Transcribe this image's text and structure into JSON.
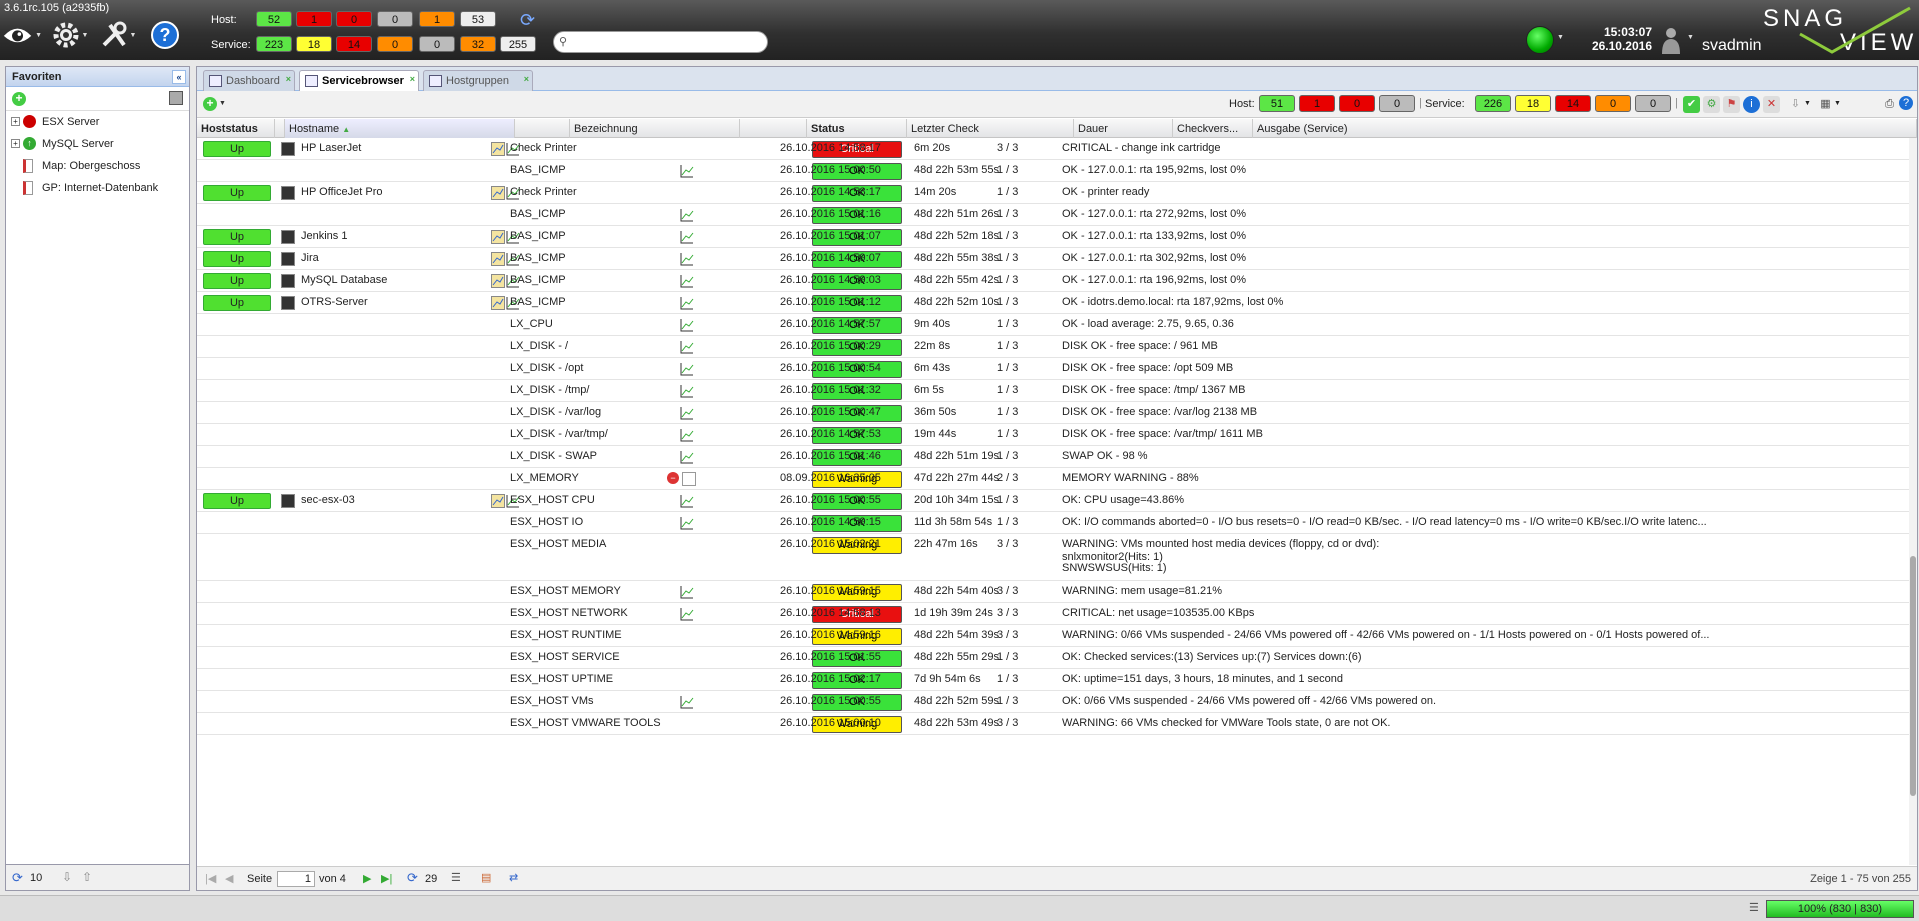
{
  "app": {
    "version": "3.6.1rc.105 (a2935fb)"
  },
  "header": {
    "host_label": "Host:",
    "service_label": "Service:",
    "host_counts": [
      "52",
      "1",
      "0",
      "0",
      "1",
      "53"
    ],
    "service_counts": [
      "223",
      "18",
      "14",
      "0",
      "0",
      "32",
      "255"
    ],
    "search_placeholder": "",
    "time": "15:03:07",
    "date": "26.10.2016",
    "user": "svadmin",
    "logo_text_top": "SNAG",
    "logo_text_bottom": "VIEW"
  },
  "sidebar": {
    "title": "Favoriten",
    "items": [
      {
        "label": "ESX Server",
        "icon": "red-circle-icon",
        "color": "#cc0000"
      },
      {
        "label": "MySQL Server",
        "icon": "green-up-icon",
        "color": "#33aa33"
      },
      {
        "label": "Map: Obergeschoss",
        "icon": "map-icon",
        "color": "#ffffff"
      },
      {
        "label": "GP: Internet-Datenbank",
        "icon": "graph-icon",
        "color": "#ffffff"
      }
    ],
    "footer_count": "10"
  },
  "tabs": [
    {
      "label": "Dashboard"
    },
    {
      "label": "Servicebrowser"
    },
    {
      "label": "Hostgruppen"
    }
  ],
  "toolbar": {
    "host_label": "Host:",
    "service_label": "Service:",
    "host_counts": [
      "51",
      "1",
      "0",
      "0"
    ],
    "service_counts": [
      "226",
      "18",
      "14",
      "0",
      "0"
    ]
  },
  "table": {
    "columns": [
      "Hoststatus",
      "Hostname",
      "Bezeichnung",
      "Status",
      "Letzter Check",
      "Dauer",
      "Checkvers...",
      "Ausgabe (Service)"
    ],
    "rows": [
      {
        "hoststatus": "Up",
        "hostname": "HP LaserJet",
        "service": "Check Printer",
        "status": "Critical",
        "last": "26.10.2016 14:58:17",
        "dauer": "6m 20s",
        "checks": "3 / 3",
        "output": "CRITICAL - change ink cartridge"
      },
      {
        "hoststatus": "",
        "hostname": "",
        "service": "BAS_ICMP",
        "status": "OK",
        "last": "26.10.2016 15:00:50",
        "dauer": "48d 22h 53m 55s",
        "checks": "1 / 3",
        "output": "OK - 127.0.0.1: rta 195,92ms, lost 0%"
      },
      {
        "hoststatus": "Up",
        "hostname": "HP OfficeJet Pro",
        "service": "Check Printer",
        "status": "OK",
        "last": "26.10.2016 14:58:17",
        "dauer": "14m 20s",
        "checks": "1 / 3",
        "output": "OK - printer ready"
      },
      {
        "hoststatus": "",
        "hostname": "",
        "service": "BAS_ICMP",
        "status": "OK",
        "last": "26.10.2016 15:01:16",
        "dauer": "48d 22h 51m 26s",
        "checks": "1 / 3",
        "output": "OK - 127.0.0.1: rta 272,92ms, lost 0%"
      },
      {
        "hoststatus": "Up",
        "hostname": "Jenkins 1",
        "service": "BAS_ICMP",
        "status": "OK",
        "last": "26.10.2016 15:01:07",
        "dauer": "48d 22h 52m 18s",
        "checks": "1 / 3",
        "output": "OK - 127.0.0.1: rta 133,92ms, lost 0%"
      },
      {
        "hoststatus": "Up",
        "hostname": "Jira",
        "service": "BAS_ICMP",
        "status": "OK",
        "last": "26.10.2016 14:59:07",
        "dauer": "48d 22h 55m 38s",
        "checks": "1 / 3",
        "output": "OK - 127.0.0.1: rta 302,92ms, lost 0%"
      },
      {
        "hoststatus": "Up",
        "hostname": "MySQL Database",
        "service": "BAS_ICMP",
        "status": "OK",
        "last": "26.10.2016 14:59:03",
        "dauer": "48d 22h 55m 42s",
        "checks": "1 / 3",
        "output": "OK - 127.0.0.1: rta 196,92ms, lost 0%"
      },
      {
        "hoststatus": "Up",
        "hostname": "OTRS-Server",
        "service": "BAS_ICMP",
        "status": "OK",
        "last": "26.10.2016 15:01:12",
        "dauer": "48d 22h 52m 10s",
        "checks": "1 / 3",
        "output": "OK - idotrs.demo.local: rta 187,92ms, lost 0%"
      },
      {
        "hoststatus": "",
        "hostname": "",
        "service": "LX_CPU",
        "status": "OK",
        "last": "26.10.2016 14:57:57",
        "dauer": "9m 40s",
        "checks": "1 / 3",
        "output": "OK - load average: 2.75, 9.65, 0.36"
      },
      {
        "hoststatus": "",
        "hostname": "",
        "service": "LX_DISK - /",
        "status": "OK",
        "last": "26.10.2016 15:00:29",
        "dauer": "22m 8s",
        "checks": "1 / 3",
        "output": "DISK OK - free space: / 961 MB"
      },
      {
        "hoststatus": "",
        "hostname": "",
        "service": "LX_DISK - /opt",
        "status": "OK",
        "last": "26.10.2016 15:00:54",
        "dauer": "6m 43s",
        "checks": "1 / 3",
        "output": "DISK OK - free space: /opt 509 MB"
      },
      {
        "hoststatus": "",
        "hostname": "",
        "service": "LX_DISK - /tmp/",
        "status": "OK",
        "last": "26.10.2016 15:01:32",
        "dauer": "6m 5s",
        "checks": "1 / 3",
        "output": "DISK OK - free space: /tmp/ 1367 MB"
      },
      {
        "hoststatus": "",
        "hostname": "",
        "service": "LX_DISK - /var/log",
        "status": "OK",
        "last": "26.10.2016 15:00:47",
        "dauer": "36m 50s",
        "checks": "1 / 3",
        "output": "DISK OK - free space: /var/log 2138 MB"
      },
      {
        "hoststatus": "",
        "hostname": "",
        "service": "LX_DISK - /var/tmp/",
        "status": "OK",
        "last": "26.10.2016 14:57:53",
        "dauer": "19m 44s",
        "checks": "1 / 3",
        "output": "DISK OK - free space: /var/tmp/ 1611 MB"
      },
      {
        "hoststatus": "",
        "hostname": "",
        "service": "LX_DISK - SWAP",
        "status": "OK",
        "last": "26.10.2016 15:01:46",
        "dauer": "48d 22h 51m 19s",
        "checks": "1 / 3",
        "output": "SWAP OK - 98 %"
      },
      {
        "hoststatus": "",
        "hostname": "",
        "service": "LX_MEMORY",
        "status": "Warning",
        "last": "08.09.2016 16:35:05",
        "dauer": "47d 22h 27m 44s",
        "checks": "2 / 3",
        "output": "MEMORY WARNING - 88%"
      },
      {
        "hoststatus": "Up",
        "hostname": "sec-esx-03",
        "service": "ESX_HOST CPU",
        "status": "OK",
        "last": "26.10.2016 15:00:55",
        "dauer": "20d 10h 34m 15s",
        "checks": "1 / 3",
        "output": "OK: CPU usage=43.86%"
      },
      {
        "hoststatus": "",
        "hostname": "",
        "service": "ESX_HOST IO",
        "status": "OK",
        "last": "26.10.2016 14:59:15",
        "dauer": "11d 3h 58m 54s",
        "checks": "1 / 3",
        "output": "OK: I/O commands aborted=0 - I/O bus resets=0 - I/O read=0 KB/sec. - I/O read latency=0 ms - I/O write=0 KB/sec.I/O write latenc..."
      },
      {
        "hoststatus": "",
        "hostname": "",
        "service": "ESX_HOST MEDIA",
        "status": "Warning",
        "last": "26.10.2016 15:02:21",
        "dauer": "22h 47m 16s",
        "checks": "3 / 3",
        "output": "WARNING: VMs mounted host media devices (floppy, cd or dvd):",
        "output2": "snlxmonitor2(Hits: 1)",
        "output3": "SNWSWSUS(Hits: 1)"
      },
      {
        "hoststatus": "",
        "hostname": "",
        "service": "ESX_HOST MEMORY",
        "status": "Warning",
        "last": "26.10.2016 14:59:15",
        "dauer": "48d 22h 54m 40s",
        "checks": "3 / 3",
        "output": "WARNING: mem usage=81.21%"
      },
      {
        "hoststatus": "",
        "hostname": "",
        "service": "ESX_HOST NETWORK",
        "status": "Critical",
        "last": "26.10.2016 14:58:13",
        "dauer": "1d 19h 39m 24s",
        "checks": "3 / 3",
        "output": "CRITICAL: net usage=103535.00 KBps"
      },
      {
        "hoststatus": "",
        "hostname": "",
        "service": "ESX_HOST RUNTIME",
        "status": "Warning",
        "last": "26.10.2016 14:59:16",
        "dauer": "48d 22h 54m 39s",
        "checks": "3 / 3",
        "output": "WARNING: 0/66 VMs suspended - 24/66 VMs powered off - 42/66 VMs powered on - 1/1 Hosts powered on - 0/1 Hosts powered of..."
      },
      {
        "hoststatus": "",
        "hostname": "",
        "service": "ESX_HOST SERVICE",
        "status": "OK",
        "last": "26.10.2016 15:01:55",
        "dauer": "48d 22h 55m 29s",
        "checks": "1 / 3",
        "output": "OK: Checked services:(13) Services up:(7) Services down:(6)"
      },
      {
        "hoststatus": "",
        "hostname": "",
        "service": "ESX_HOST UPTIME",
        "status": "OK",
        "last": "26.10.2016 15:02:17",
        "dauer": "7d 9h 54m 6s",
        "checks": "1 / 3",
        "output": "OK: uptime=151 days, 3 hours, 18 minutes, and 1 second"
      },
      {
        "hoststatus": "",
        "hostname": "",
        "service": "ESX_HOST VMs",
        "status": "OK",
        "last": "26.10.2016 15:00:55",
        "dauer": "48d 22h 52m 59s",
        "checks": "1 / 3",
        "output": "OK: 0/66 VMs suspended - 24/66 VMs powered off - 42/66 VMs powered on."
      },
      {
        "hoststatus": "",
        "hostname": "",
        "service": "ESX_HOST VMWARE TOOLS",
        "status": "Warning",
        "last": "26.10.2016 15:00:10",
        "dauer": "48d 22h 53m 49s",
        "checks": "3 / 3",
        "output": "WARNING: 66 VMs checked for VMWare Tools state, 0 are not OK."
      }
    ]
  },
  "pager": {
    "page_label": "Seite",
    "page": "1",
    "of_label": "von 4",
    "refresh_count": "29",
    "summary": "Zeige 1 - 75 von 255"
  },
  "statusbar": {
    "memory": "100% (830 | 830)"
  }
}
